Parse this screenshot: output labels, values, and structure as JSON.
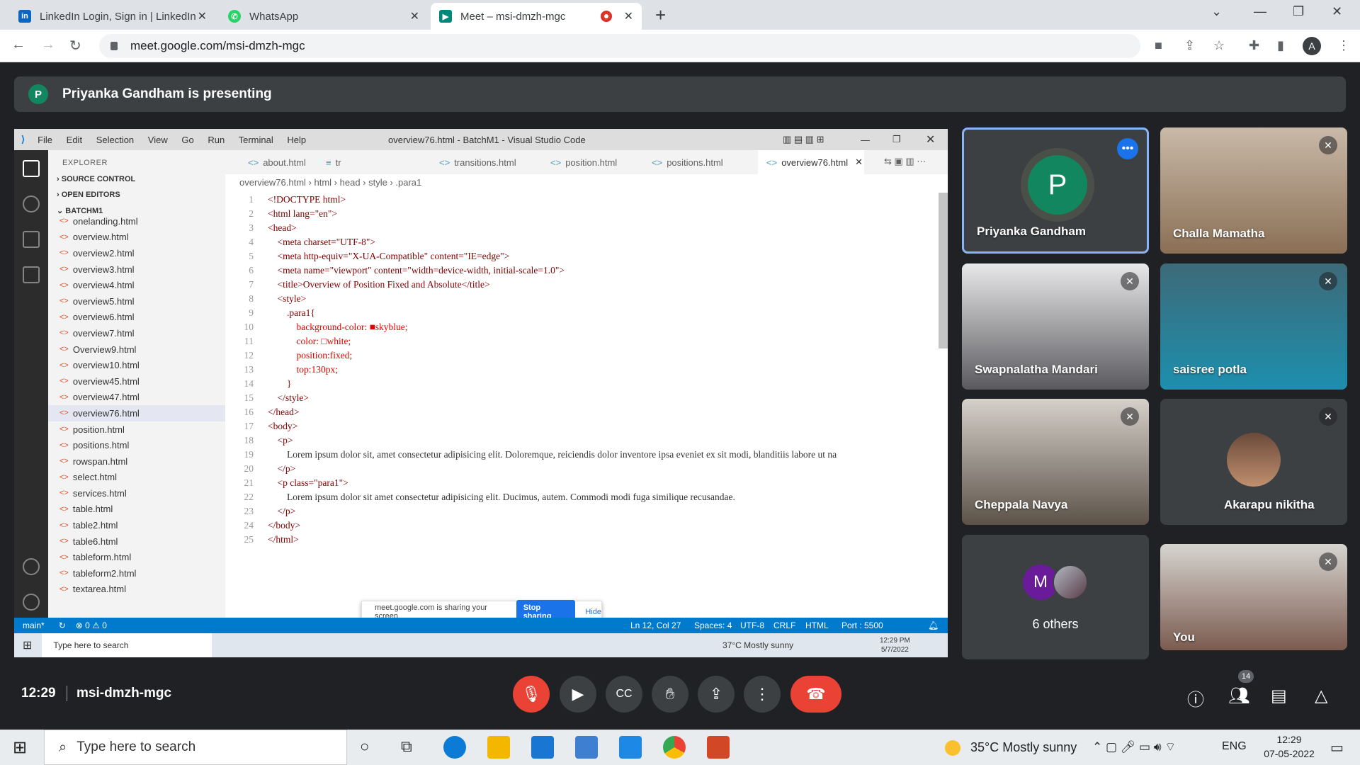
{
  "browser": {
    "tabs": [
      {
        "title": "LinkedIn Login, Sign in | LinkedIn",
        "favicon": "linkedin-icon"
      },
      {
        "title": "WhatsApp",
        "favicon": "whatsapp-icon"
      },
      {
        "title": "Meet – msi-dmzh-mgc",
        "favicon": "meet-icon"
      }
    ],
    "url": "meet.google.com/msi-dmzh-mgc",
    "profile_initial": "A"
  },
  "meet": {
    "presenter_initial": "P",
    "presenting_banner": "Priyanka Gandham is presenting",
    "time": "12:29",
    "meeting_code": "msi-dmzh-mgc",
    "participants_count": "14",
    "participants": [
      {
        "name": "Priyanka Gandham",
        "initial": "P"
      },
      {
        "name": "Challa Mamatha"
      },
      {
        "name": "Swapnalatha Mandari"
      },
      {
        "name": "saisree potla"
      },
      {
        "name": "Cheppala Navya"
      },
      {
        "name": "Akarapu nikitha"
      },
      {
        "name": "6 others",
        "initial": "M"
      },
      {
        "name": "You"
      }
    ]
  },
  "vscode": {
    "menu": [
      "File",
      "Edit",
      "Selection",
      "View",
      "Go",
      "Run",
      "Terminal",
      "Help"
    ],
    "window_title": "overview76.html - BatchM1 - Visual Studio Code",
    "explorer_label": "EXPLORER",
    "sections": [
      "SOURCE CONTROL",
      "OPEN EDITORS",
      "BATCHM1"
    ],
    "files": [
      "onelanding.html",
      "overview.html",
      "overview2.html",
      "overview3.html",
      "overview4.html",
      "overview5.html",
      "overview6.html",
      "overview7.html",
      "Overview9.html",
      "overview10.html",
      "overview45.html",
      "overview47.html",
      "overview76.html",
      "position.html",
      "positions.html",
      "rowspan.html",
      "select.html",
      "services.html",
      "table.html",
      "table2.html",
      "table6.html",
      "tableform.html",
      "tableform2.html",
      "textarea.html"
    ],
    "selected_file": "overview76.html",
    "tabs": [
      "about.html",
      "tr",
      "transitions.html",
      "position.html",
      "positions.html",
      "overview76.html"
    ],
    "breadcrumb": [
      "overview76.html",
      "html",
      "head",
      "style",
      ".para1"
    ],
    "status": {
      "branch": "main*",
      "problems": "⊗ 0 ⚠ 0",
      "position": "Ln 12, Col 27",
      "spaces": "Spaces: 4",
      "encoding": "UTF-8",
      "eol": "CRLF",
      "lang": "HTML",
      "port": "Port : 5500"
    },
    "share_banner": {
      "text": "meet.google.com is sharing your screen.",
      "stop": "Stop sharing",
      "hide": "Hide"
    },
    "inner_taskbar": {
      "search": "Type here to search",
      "weather": "37°C  Mostly sunny",
      "time": "12:29 PM",
      "date": "5/7/2022"
    }
  },
  "code_lines": [
    [
      "<!DOCTYPE html>"
    ],
    [
      "<html lang=\"en\">"
    ],
    [
      "<head>"
    ],
    [
      "    <meta charset=\"UTF-8\">"
    ],
    [
      "    <meta http-equiv=\"X-UA-Compatible\" content=\"IE=edge\">"
    ],
    [
      "    <meta name=\"viewport\" content=\"width=device-width, initial-scale=1.0\">"
    ],
    [
      "    <title>Overview of Position Fixed and Absolute</title>"
    ],
    [
      "    <style>"
    ],
    [
      "        .para1{"
    ],
    [
      "            background-color: ■skyblue;"
    ],
    [
      "            color: □white;"
    ],
    [
      "            position:fixed;"
    ],
    [
      "            top:130px;"
    ],
    [
      "        }"
    ],
    [
      "    </style>"
    ],
    [
      "</head>"
    ],
    [
      "<body>"
    ],
    [
      "    <p>"
    ],
    [
      "        Lorem ipsum dolor sit, amet consectetur adipisicing elit. Doloremque, reiciendis dolor inventore ipsa eveniet ex sit modi, blanditiis labore ut na"
    ],
    [
      "    </p>"
    ],
    [
      "    <p class=\"para1\">"
    ],
    [
      "        Lorem ipsum dolor sit amet consectetur adipisicing elit. Ducimus, autem. Commodi modi fuga similique recusandae."
    ],
    [
      "    </p>"
    ],
    [
      "</body>"
    ],
    [
      "</html>"
    ]
  ],
  "taskbar": {
    "search_placeholder": "Type here to search",
    "weather": "35°C  Mostly sunny",
    "lang": "ENG",
    "time": "12:29",
    "date": "07-05-2022"
  },
  "colors": {
    "meet_bg": "#202124",
    "end_call": "#ea4335",
    "accent": "#8ab4f8",
    "vscode_status": "#007acc"
  }
}
